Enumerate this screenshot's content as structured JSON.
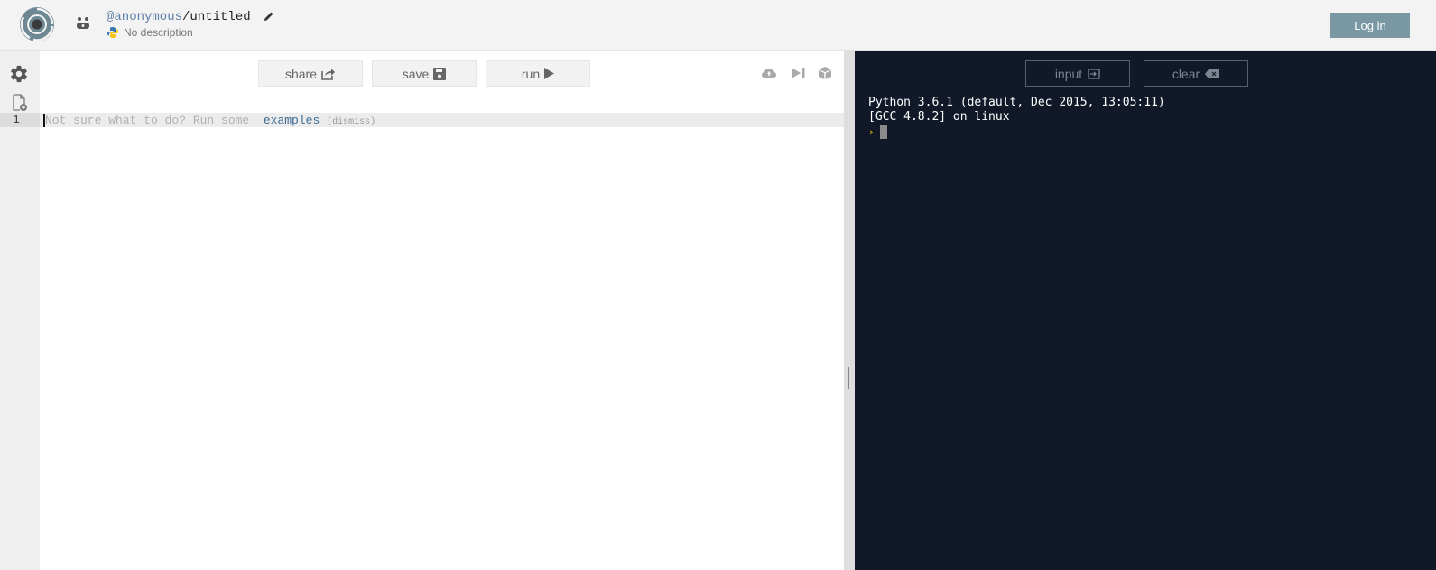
{
  "header": {
    "owner": "@anonymous",
    "separator": "/",
    "repl_name": "untitled",
    "description": "No description",
    "login_label": "Log in",
    "icons": {
      "logo": "spiral-logo-icon",
      "user": "anonymous-user-icon",
      "edit": "pencil-icon",
      "language": "python-icon"
    }
  },
  "editor": {
    "toolbar": {
      "share_label": "share",
      "save_label": "save",
      "run_label": "run"
    },
    "line_numbers": [
      "1"
    ],
    "hint": {
      "prefix": "Not sure what to do? Run some  ",
      "link": "examples",
      "dismiss": "(dismiss)"
    },
    "icons": [
      "settings-gear-icon",
      "new-file-icon",
      "upload-cloud-icon",
      "step-forward-icon",
      "package-cube-icon"
    ]
  },
  "console": {
    "input_label": "input",
    "clear_label": "clear",
    "lines": [
      "Python 3.6.1 (default, Dec 2015, 13:05:11)",
      "[GCC 4.8.2] on linux"
    ],
    "prompt": "›"
  },
  "colors": {
    "accent": "#7a98a4",
    "console_bg": "#111827",
    "link": "#3d6b93",
    "prompt": "#f5c518"
  }
}
